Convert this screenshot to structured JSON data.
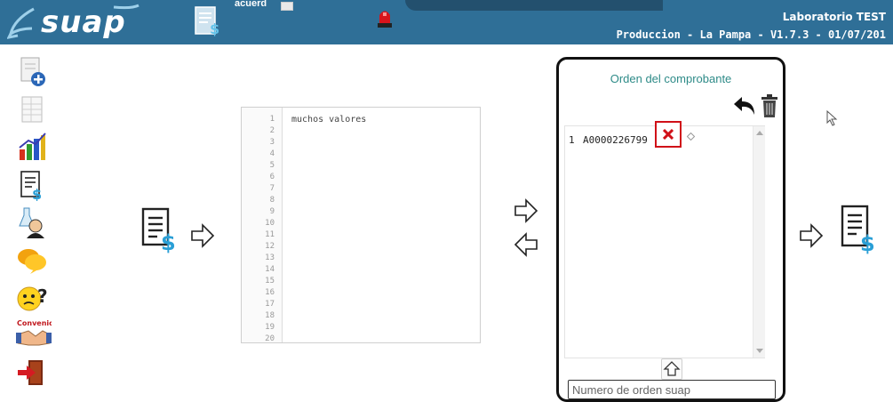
{
  "header": {
    "logo_text": "suap",
    "account_label": "acuerd",
    "user": "Laboratorio TEST",
    "environment": "Produccion - La Pampa - V1.7.3 - 01/07/201"
  },
  "sidebar": {
    "items": [
      {
        "icon": "add-document-icon"
      },
      {
        "icon": "spreadsheet-icon"
      },
      {
        "icon": "bar-chart-icon"
      },
      {
        "icon": "billing-document-icon"
      },
      {
        "icon": "lab-user-icon"
      },
      {
        "icon": "chat-bubbles-icon"
      },
      {
        "icon": "help-face-icon"
      },
      {
        "icon": "agreement-icon",
        "label": "Convenio"
      },
      {
        "icon": "exit-icon"
      }
    ]
  },
  "editor": {
    "lines": [
      "1",
      "2",
      "3",
      "4",
      "5",
      "6",
      "7",
      "8",
      "9",
      "10",
      "11",
      "12",
      "13",
      "14",
      "15",
      "16",
      "17",
      "18",
      "19",
      "20"
    ],
    "content": "muchos valores"
  },
  "panel": {
    "title": "Orden del comprobante",
    "rows": [
      {
        "index": "1",
        "value": "A0000226799"
      }
    ],
    "input_placeholder": "Numero de orden suap"
  },
  "colors": {
    "header_bg": "#2f6f97",
    "title_teal": "#2e8b88",
    "delete_red": "#d01018"
  }
}
